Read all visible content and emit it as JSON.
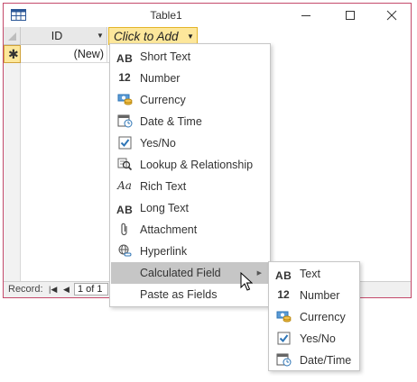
{
  "window": {
    "title": "Table1"
  },
  "grid": {
    "id_header": "ID",
    "add_header": "Click to Add",
    "new_row_label": "(New)",
    "new_row_marker": "✱"
  },
  "record_bar": {
    "label": "Record:",
    "position": "1 of 1"
  },
  "menu": {
    "items": [
      {
        "icon": "short-text-icon",
        "glyph": "AB",
        "label": "Short Text"
      },
      {
        "icon": "number-icon",
        "glyph": "12",
        "label": "Number"
      },
      {
        "icon": "currency-icon",
        "glyph": "",
        "label": "Currency"
      },
      {
        "icon": "date-time-icon",
        "glyph": "",
        "label": "Date & Time"
      },
      {
        "icon": "yes-no-icon",
        "glyph": "",
        "label": "Yes/No"
      },
      {
        "icon": "lookup-icon",
        "glyph": "",
        "label": "Lookup & Relationship"
      },
      {
        "icon": "rich-text-icon",
        "glyph": "Aa",
        "label": "Rich Text"
      },
      {
        "icon": "long-text-icon",
        "glyph": "AB",
        "label": "Long Text"
      },
      {
        "icon": "attachment-icon",
        "glyph": "",
        "label": "Attachment"
      },
      {
        "icon": "hyperlink-icon",
        "glyph": "",
        "label": "Hyperlink"
      },
      {
        "icon": "",
        "glyph": "",
        "label": "Calculated Field"
      },
      {
        "icon": "",
        "glyph": "",
        "label": "Paste as Fields"
      }
    ]
  },
  "submenu": {
    "items": [
      {
        "icon": "text-icon",
        "glyph": "AB",
        "label": "Text"
      },
      {
        "icon": "number-icon",
        "glyph": "12",
        "label": "Number"
      },
      {
        "icon": "currency-icon",
        "glyph": "",
        "label": "Currency"
      },
      {
        "icon": "yes-no-icon",
        "glyph": "",
        "label": "Yes/No"
      },
      {
        "icon": "date-time-icon",
        "glyph": "",
        "label": "Date/Time"
      }
    ]
  },
  "colors": {
    "window_border": "#c44a6b",
    "add_header_fill": "#fde79b",
    "highlight": "#c6c6c6"
  }
}
